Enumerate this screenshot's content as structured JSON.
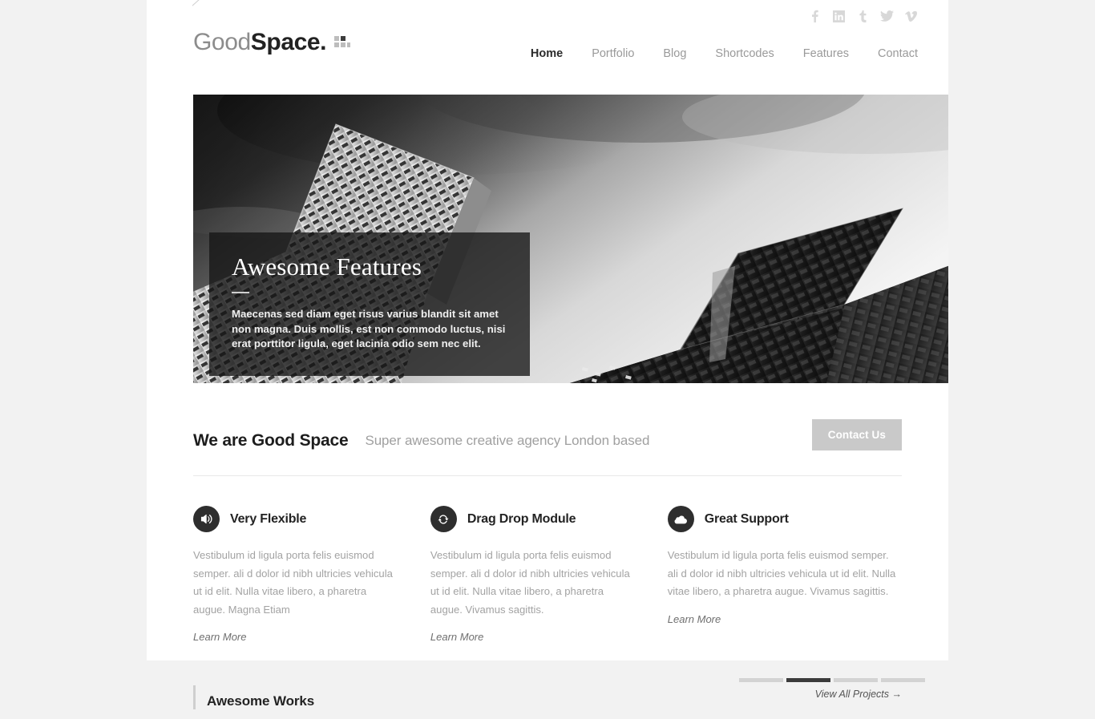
{
  "site": {
    "logo_light": "Good",
    "logo_bold": "Space.",
    "logo_mark_icon": "grid-squares-icon"
  },
  "social": [
    {
      "name": "facebook",
      "label": "f"
    },
    {
      "name": "linkedin",
      "label": "in"
    },
    {
      "name": "tumblr",
      "label": "t"
    },
    {
      "name": "twitter",
      "label": "twitter-bird"
    },
    {
      "name": "vimeo",
      "label": "v"
    }
  ],
  "nav": {
    "items": [
      {
        "label": "Home",
        "active": true
      },
      {
        "label": "Portfolio",
        "active": false
      },
      {
        "label": "Blog",
        "active": false
      },
      {
        "label": "Shortcodes",
        "active": false
      },
      {
        "label": "Features",
        "active": false
      },
      {
        "label": "Contact",
        "active": false
      }
    ]
  },
  "slider": {
    "caption_title": "Awesome Features",
    "caption_text": "Maecenas sed diam eget risus varius blandit sit amet non magna. Duis mollis, est non commodo luctus, nisi erat porttitor ligula, eget lacinia odio sem nec elit.",
    "image_alt": "black and white photograph of two modern skyscrapers shot from below against a dark cloudy sky",
    "pager": [
      {
        "index": 1,
        "active": false
      },
      {
        "index": 2,
        "active": true
      },
      {
        "index": 3,
        "active": false
      },
      {
        "index": 4,
        "active": false
      }
    ]
  },
  "intro": {
    "heading": "We are Good Space",
    "tagline": "Super awesome creative agency London based",
    "button_label": "Contact Us"
  },
  "features": [
    {
      "icon": "speaker-volume-icon",
      "title": "Very Flexible",
      "body": "Vestibulum id ligula porta felis euismod semper. ali d dolor id nibh ultricies vehicula ut id elit. Nulla vitae libero, a pharetra augue. Magna Etiam",
      "link_label": "Learn More"
    },
    {
      "icon": "refresh-reload-icon",
      "title": "Drag Drop Module",
      "body": "Vestibulum id ligula porta felis euismod semper. ali d dolor id nibh ultricies vehicula ut id elit. Nulla vitae libero, a pharetra augue. Vivamus sagittis.",
      "link_label": "Learn More"
    },
    {
      "icon": "cloud-icon",
      "title": "Great Support",
      "body": "Vestibulum id ligula porta felis euismod semper. ali d dolor id nibh ultricies vehicula ut id elit. Nulla vitae libero, a pharetra augue. Vivamus sagittis.",
      "link_label": "Learn More"
    }
  ],
  "works": {
    "heading": "Awesome Works",
    "link_label": "View All Projects →"
  },
  "colors": {
    "page_background": "#f2f2f2",
    "content_background": "#ffffff",
    "text_dark": "#232323",
    "text_muted": "#a3a3a3",
    "nav_inactive": "#9a9a9a",
    "accent_dark": "#2e2e2e",
    "button_grey": "#c9c9c9"
  }
}
